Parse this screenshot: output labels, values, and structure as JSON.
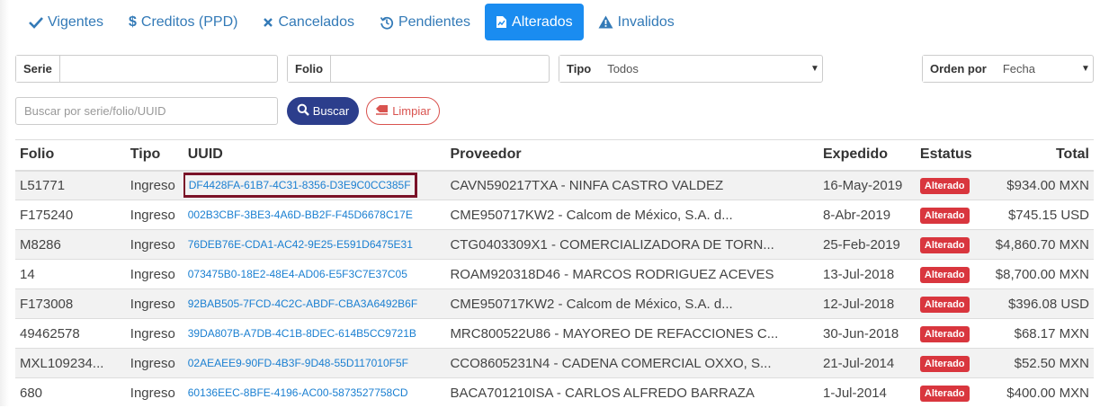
{
  "tabs": [
    {
      "label": "Vigentes",
      "icon": "check-icon"
    },
    {
      "label": "Creditos (PPD)",
      "icon": "dollar-icon"
    },
    {
      "label": "Cancelados",
      "icon": "times-icon"
    },
    {
      "label": "Pendientes",
      "icon": "history-icon"
    },
    {
      "label": "Alterados",
      "icon": "file-alert-icon",
      "active": true
    },
    {
      "label": "Invalidos",
      "icon": "warning-icon"
    }
  ],
  "filters": {
    "serie_label": "Serie",
    "serie_value": "",
    "folio_label": "Folio",
    "folio_value": "",
    "tipo_label": "Tipo",
    "tipo_value": "Todos",
    "orden_label": "Orden por",
    "orden_value": "Fecha",
    "search_placeholder": "Buscar por serie/folio/UUID",
    "buscar_label": "Buscar",
    "limpiar_label": "Limpiar"
  },
  "table": {
    "headers": {
      "folio": "Folio",
      "tipo": "Tipo",
      "uuid": "UUID",
      "proveedor": "Proveedor",
      "expedido": "Expedido",
      "estatus": "Estatus",
      "total": "Total"
    },
    "rows": [
      {
        "folio": "L51771",
        "tipo": "Ingreso",
        "uuid": "DF4428FA-61B7-4C31-8356-D3E9C0CC385F",
        "proveedor": "CAVN590217TXA - NINFA CASTRO VALDEZ",
        "expedido": "16-May-2019",
        "estatus": "Alterado",
        "total": "$934.00 MXN"
      },
      {
        "folio": "F175240",
        "tipo": "Ingreso",
        "uuid": "002B3CBF-3BE3-4A6D-BB2F-F45D6678C17E",
        "proveedor": "CME950717KW2 - Calcom de México, S.A. d...",
        "expedido": "8-Abr-2019",
        "estatus": "Alterado",
        "total": "$745.15 USD"
      },
      {
        "folio": "M8286",
        "tipo": "Ingreso",
        "uuid": "76DEB76E-CDA1-AC42-9E25-E591D6475E31",
        "proveedor": "CTG0403309X1 - COMERCIALIZADORA DE TORN...",
        "expedido": "25-Feb-2019",
        "estatus": "Alterado",
        "total": "$4,860.70 MXN"
      },
      {
        "folio": "14",
        "tipo": "Ingreso",
        "uuid": "073475B0-18E2-48E4-AD06-E5F3C7E37C05",
        "proveedor": "ROAM920318D46 - MARCOS RODRIGUEZ ACEVES",
        "expedido": "13-Jul-2018",
        "estatus": "Alterado",
        "total": "$8,700.00 MXN"
      },
      {
        "folio": "F173008",
        "tipo": "Ingreso",
        "uuid": "92BAB505-7FCD-4C2C-ABDF-CBA3A6492B6F",
        "proveedor": "CME950717KW2 - Calcom de México, S.A. d...",
        "expedido": "12-Jul-2018",
        "estatus": "Alterado",
        "total": "$396.08 USD"
      },
      {
        "folio": "49462578",
        "tipo": "Ingreso",
        "uuid": "39DA807B-A7DB-4C1B-8DEC-614B5CC9721B",
        "proveedor": "MRC800522U86 - MAYOREO DE REFACCIONES C...",
        "expedido": "30-Jun-2018",
        "estatus": "Alterado",
        "total": "$68.17 MXN"
      },
      {
        "folio": "MXL109234...",
        "tipo": "Ingreso",
        "uuid": "02AEAEE9-90FD-4B3F-9D48-55D117010F5F",
        "proveedor": "CCO8605231N4 - CADENA COMERCIAL OXXO, S...",
        "expedido": "21-Jul-2014",
        "estatus": "Alterado",
        "total": "$52.50 MXN"
      },
      {
        "folio": "680",
        "tipo": "Ingreso",
        "uuid": "60136EEC-8BFE-4196-AC00-5873527758CD",
        "proveedor": "BACA701210ISA - CARLOS ALFREDO BARRAZA",
        "expedido": "1-Jul-2014",
        "estatus": "Alterado",
        "total": "$400.00 MXN"
      }
    ]
  }
}
